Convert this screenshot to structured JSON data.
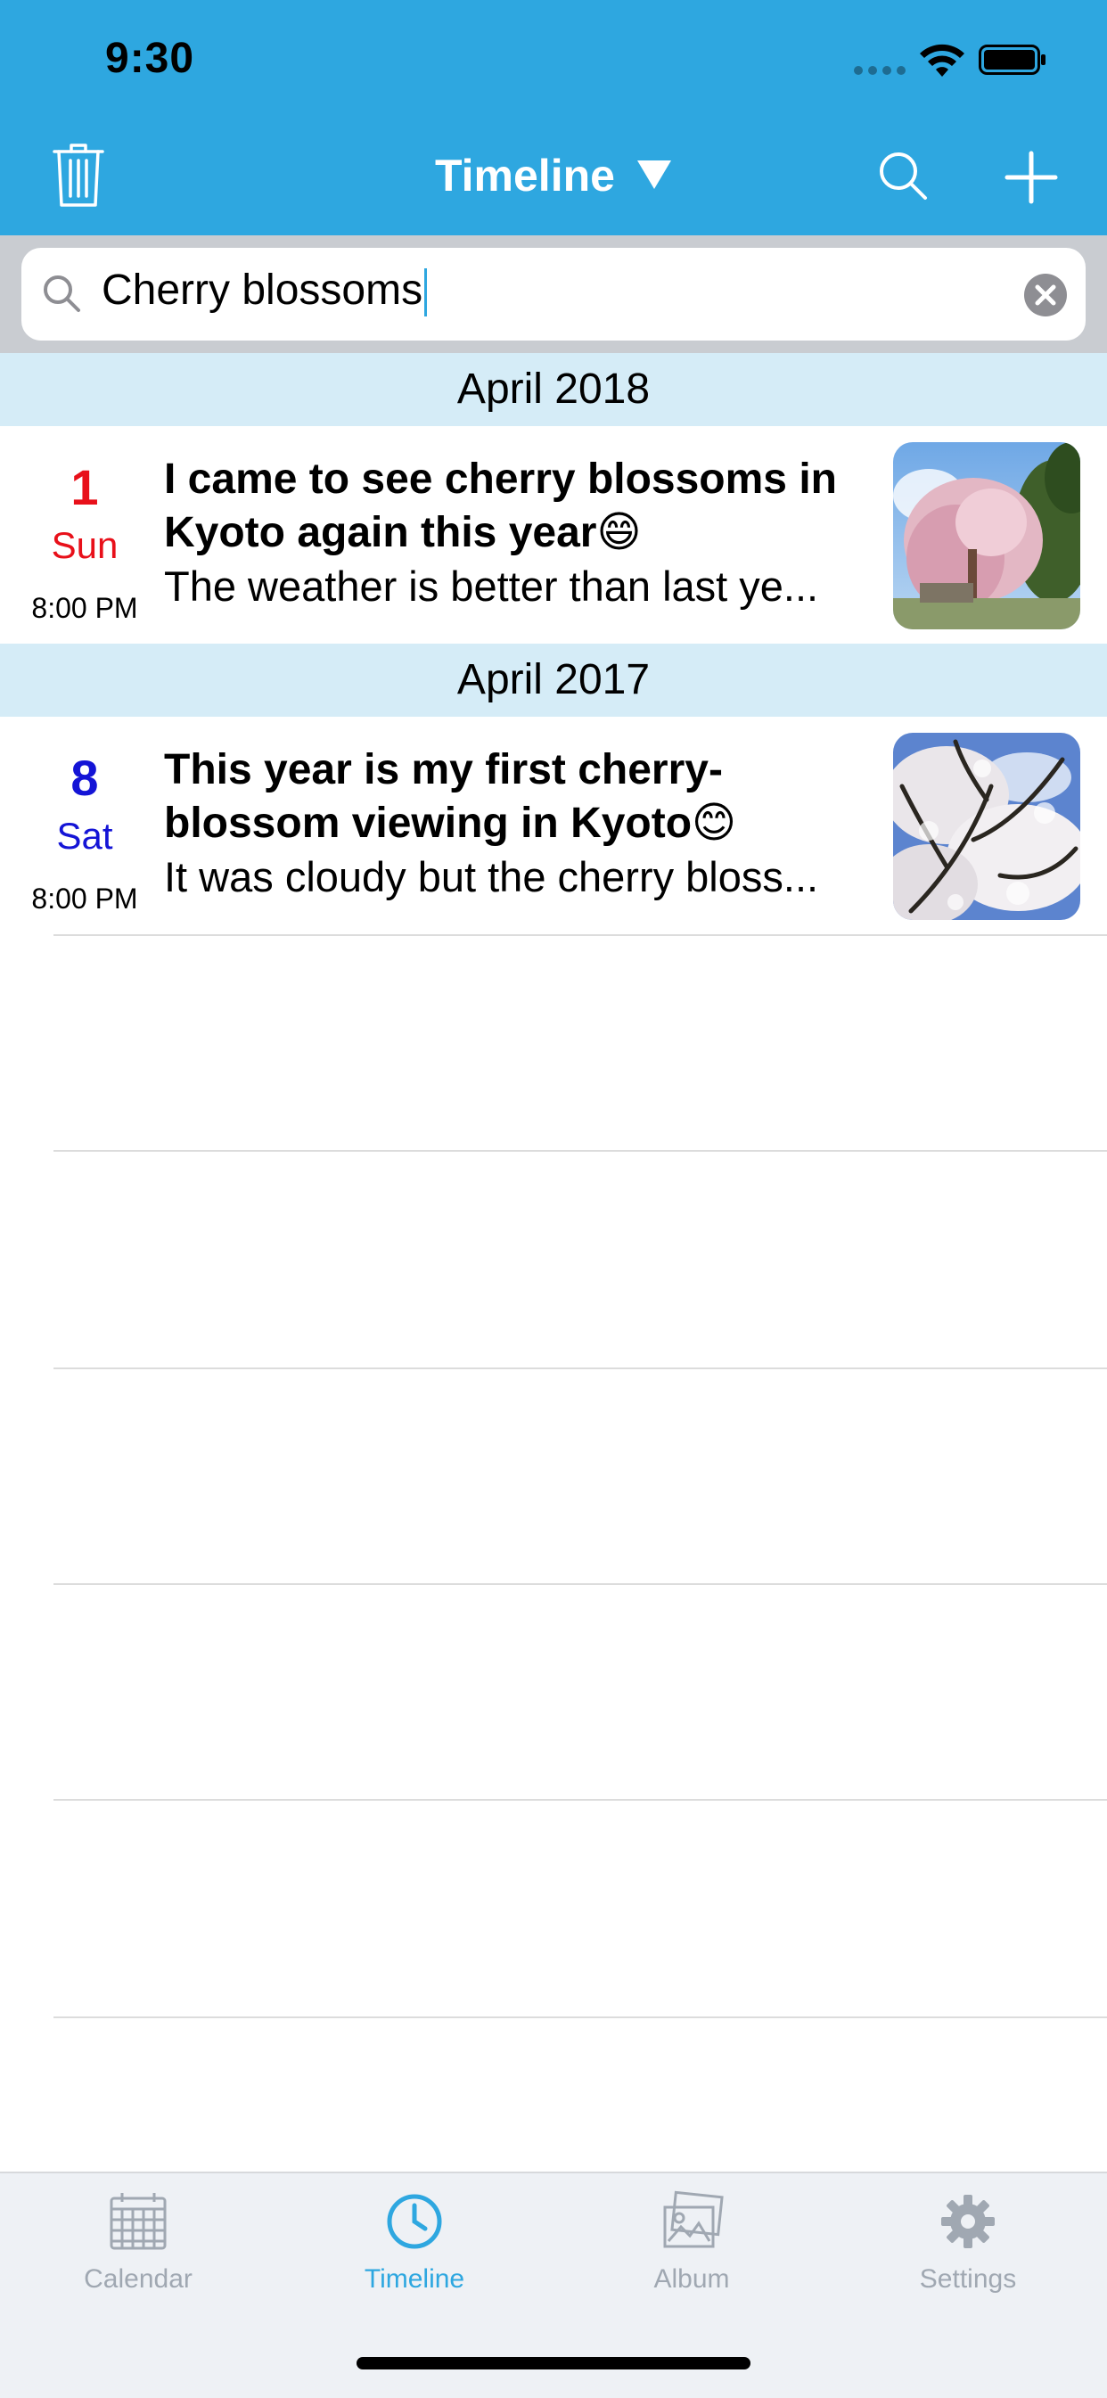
{
  "status_bar": {
    "time": "9:30"
  },
  "nav": {
    "title": "Timeline",
    "caret": "▼",
    "left_icon": "trash-icon",
    "right_icons": [
      "search-icon",
      "plus-icon"
    ]
  },
  "search": {
    "value": "Cherry blossoms"
  },
  "sections": [
    {
      "header": "April 2018",
      "entries": [
        {
          "day": "1",
          "weekday": "Sun",
          "time": "8:00 PM",
          "title_line1": "I came to see cherry blossoms in",
          "title_line2": "Kyoto again this year😄",
          "preview": "The weather is better than last ye...",
          "day_color": "#e8101a"
        }
      ]
    },
    {
      "header": "April 2017",
      "entries": [
        {
          "day": "8",
          "weekday": "Sat",
          "time": "8:00 PM",
          "title_line1": "This year is my first cherry-",
          "title_line2": "blossom viewing in Kyoto😊",
          "preview": "It was cloudy but the cherry bloss...",
          "day_color": "#1414d6"
        }
      ]
    }
  ],
  "tabs": [
    {
      "label": "Calendar",
      "icon": "calendar-icon",
      "active": false
    },
    {
      "label": "Timeline",
      "icon": "clock-icon",
      "active": true
    },
    {
      "label": "Album",
      "icon": "photos-icon",
      "active": false
    },
    {
      "label": "Settings",
      "icon": "gear-icon",
      "active": false
    }
  ],
  "colors": {
    "accent": "#2ea7e0",
    "section_bg": "#d5ecf7",
    "tab_inactive": "#a0a8b2"
  }
}
